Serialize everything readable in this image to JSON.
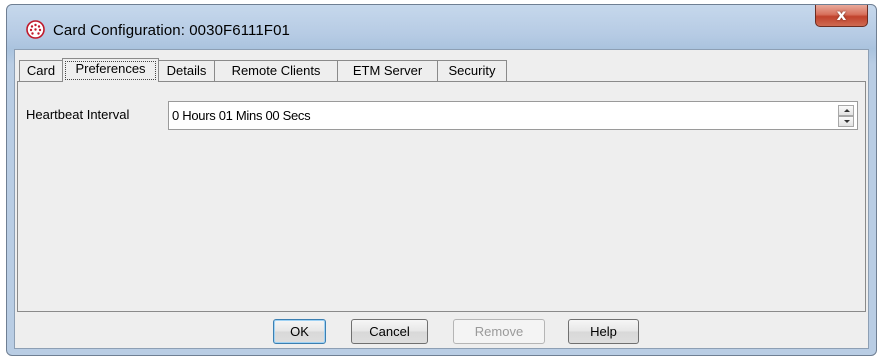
{
  "window": {
    "title": "Card Configuration: 0030F6111F01",
    "close_glyph": "x",
    "icon": "network-globe-icon",
    "accent_color": "#c0422c"
  },
  "tabs": [
    {
      "label": "Card",
      "active": false
    },
    {
      "label": "Preferences",
      "active": true
    },
    {
      "label": "Details",
      "active": false
    },
    {
      "label": "Remote Clients",
      "active": false
    },
    {
      "label": "ETM Server",
      "active": false
    },
    {
      "label": "Security",
      "active": false
    }
  ],
  "preferences": {
    "heartbeat_label": "Heartbeat Interval",
    "heartbeat_value": "0 Hours 01 Mins 00 Secs"
  },
  "buttons": {
    "ok": "OK",
    "cancel": "Cancel",
    "remove": "Remove",
    "help": "Help"
  }
}
